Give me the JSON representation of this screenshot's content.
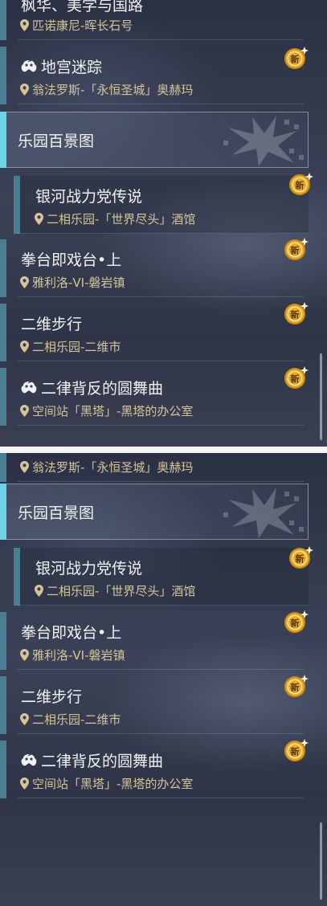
{
  "top_panel": {
    "partial_card": {
      "title": "枫华、美学与国路",
      "location": "匹诺康尼-晖长石号"
    },
    "card_labyrinth": {
      "title": "地宫迷踪",
      "location": "翁法罗斯-「永恒圣城」奥赫玛",
      "badge": "新"
    },
    "category": {
      "title": "乐园百景图"
    },
    "cards": [
      {
        "title": "银河战力党传说",
        "location": "二相乐园-「世界尽头」酒馆",
        "badge": "新"
      },
      {
        "title": "拳台即戏台•上",
        "location": "雅利洛-VI-磐岩镇",
        "badge": "新"
      },
      {
        "title": "二维步行",
        "location": "二相乐园-二维市",
        "badge": "新"
      },
      {
        "title": "二律背反的圆舞曲",
        "location": "空间站「黑塔」-黑塔的办公室",
        "badge": "新"
      }
    ]
  },
  "bottom_panel": {
    "partial_location": "翁法罗斯-「永恒圣城」奥赫玛",
    "category": {
      "title": "乐园百景图"
    },
    "cards": [
      {
        "title": "银河战力党传说",
        "location": "二相乐园-「世界尽头」酒馆",
        "badge": "新"
      },
      {
        "title": "拳台即戏台•上",
        "location": "雅利洛-VI-磐岩镇",
        "badge": "新"
      },
      {
        "title": "二维步行",
        "location": "二相乐园-二维市",
        "badge": "新"
      },
      {
        "title": "二律背反的圆舞曲",
        "location": "空间站「黑塔」-黑塔的办公室",
        "badge": "新"
      }
    ]
  },
  "colors": {
    "accent_cyan": "#6fd3e8",
    "accent_teal": "#4b7d93",
    "location_gold": "#d6c39a",
    "badge_gold": "#e9a826"
  },
  "icons": [
    "map-pin-icon",
    "game-controller-icon",
    "new-badge-icon",
    "category-emblem-icon"
  ]
}
